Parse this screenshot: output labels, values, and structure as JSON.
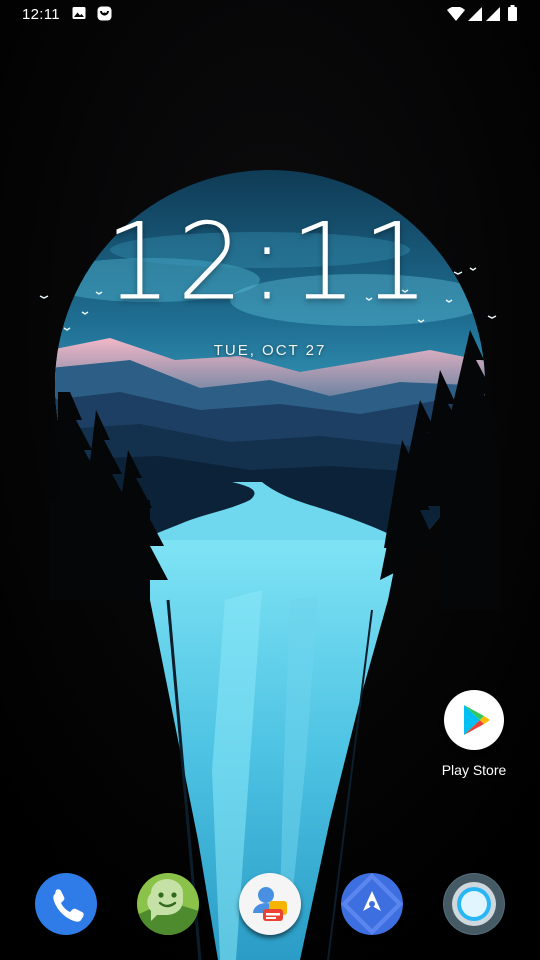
{
  "status_bar": {
    "time": "12:11",
    "left_icons": [
      "image-notification-icon",
      "launcher-notification-icon"
    ],
    "right_icons": [
      "wifi-icon",
      "signal-icon",
      "signal-icon",
      "battery-icon"
    ]
  },
  "lockscreen_clock": {
    "time": "12:11",
    "date": "TUE, OCT 27"
  },
  "home_shortcuts": [
    {
      "label": "Play Store",
      "icon": "play-store-icon"
    }
  ],
  "dock": [
    {
      "icon": "phone-icon",
      "color": "#2f7be8"
    },
    {
      "icon": "messaging-icon",
      "color": "#8bc34a"
    },
    {
      "icon": "contacts-icon",
      "color": "#f5f5f5"
    },
    {
      "icon": "navigation-icon",
      "color": "#3d6fe0"
    },
    {
      "icon": "camera-icon",
      "color": "#546e7a"
    }
  ]
}
